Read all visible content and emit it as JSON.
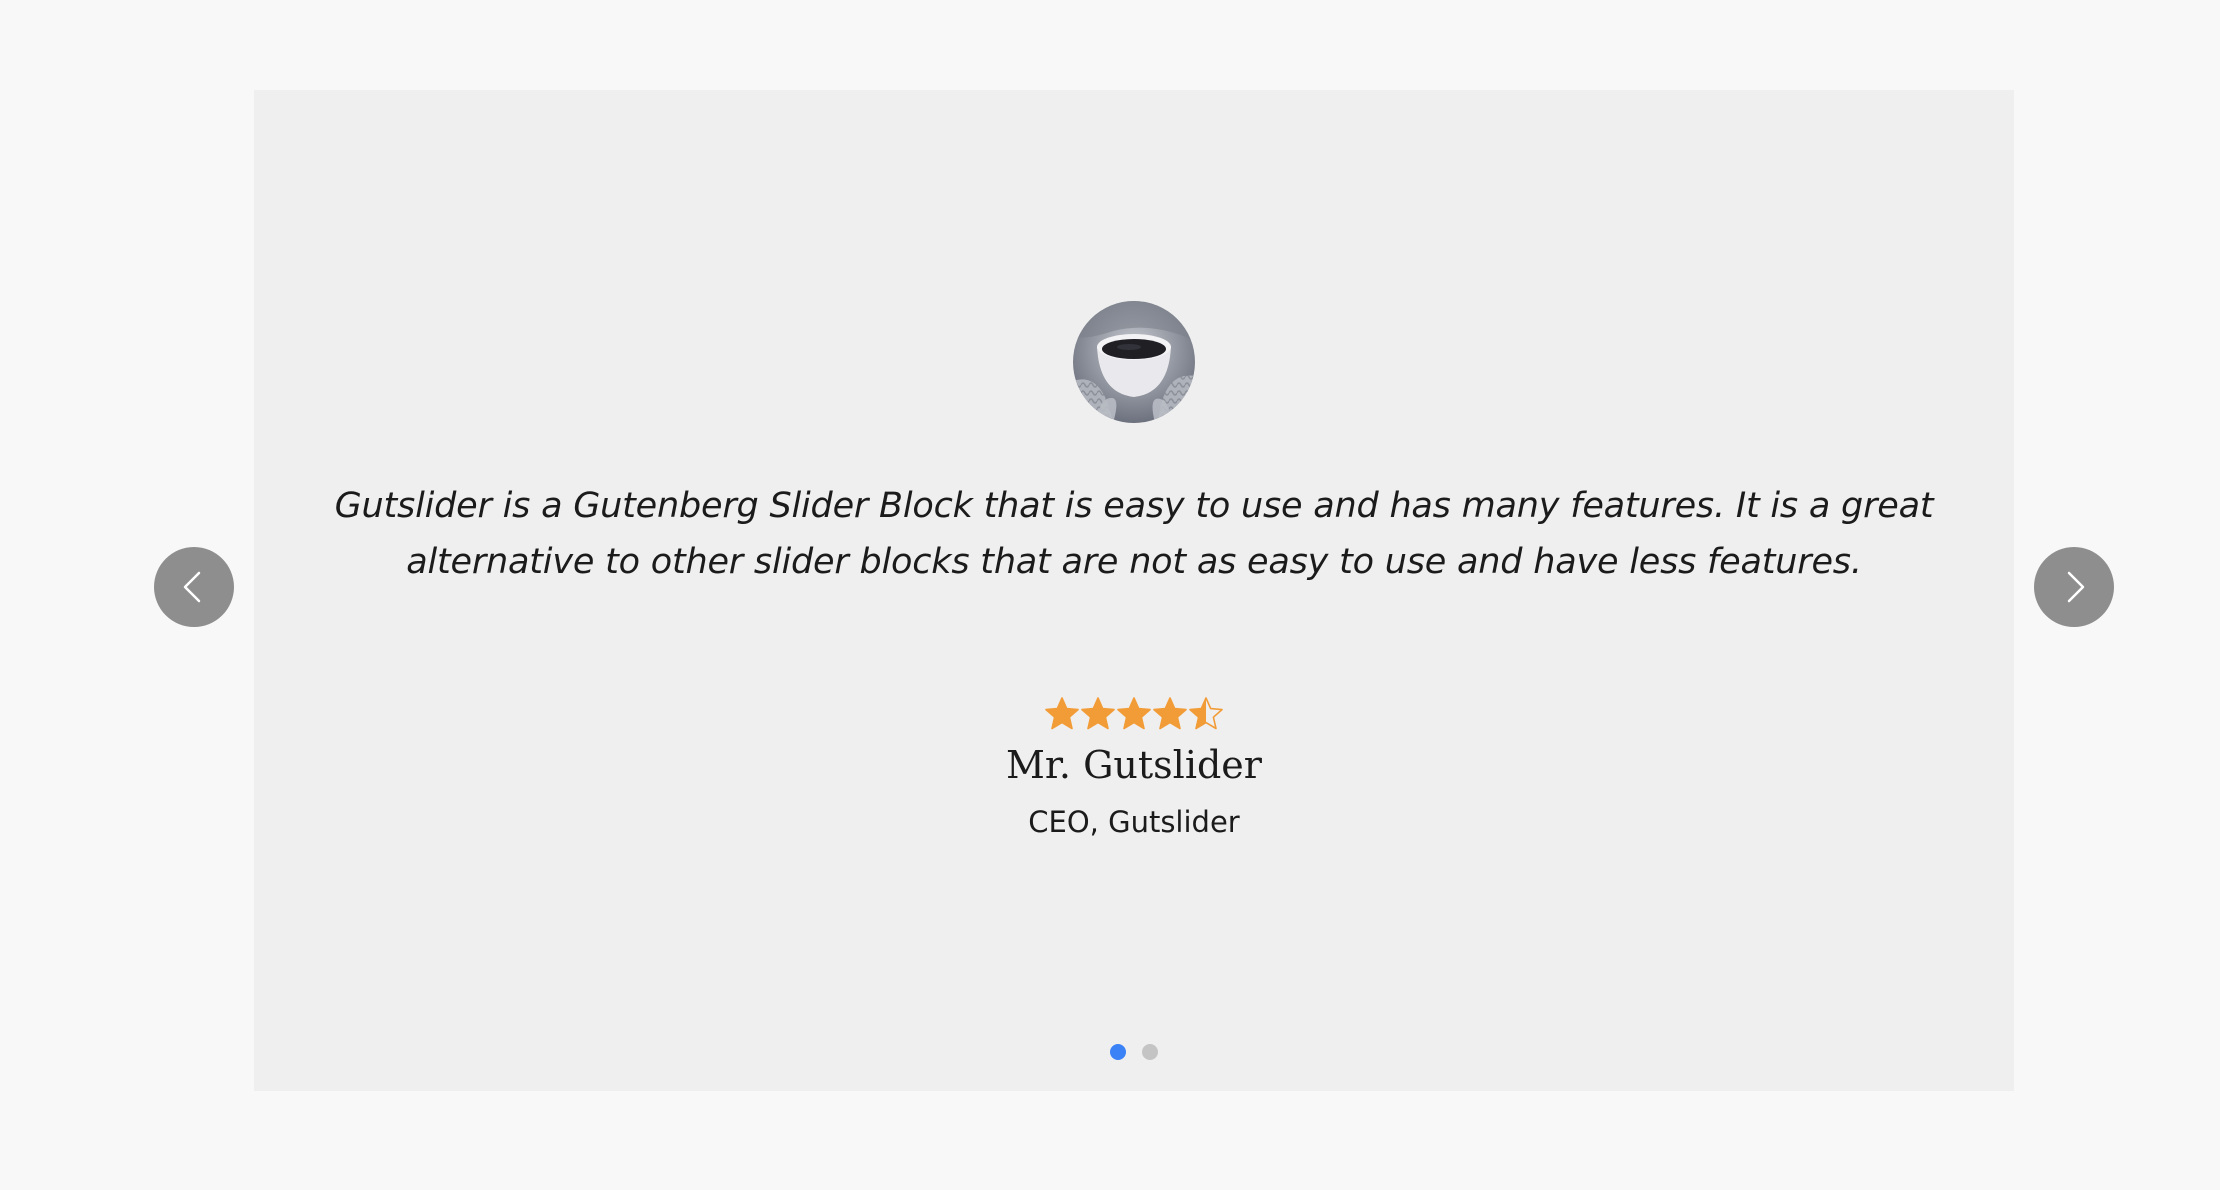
{
  "testimonial": {
    "quote": "Gutslider is a Gutenberg Slider Block that is easy to use and has many features. It is a great alternative to other slider blocks that are not as easy to use and have less features.",
    "name": "Mr. Gutslider",
    "role": "CEO, Gutslider",
    "rating": 4.5,
    "rating_max": 5,
    "avatar_icon": "coffee-cup-photo"
  },
  "navigation": {
    "prev_icon": "chevron-left-icon",
    "next_icon": "chevron-right-icon"
  },
  "pagination": {
    "slide_count": 2,
    "active_index": 0
  },
  "colors": {
    "star": "#f29c38",
    "active_dot": "#3b82f6",
    "inactive_dot": "#c4c4c4",
    "nav_button": "#8e8e8e",
    "slide_background": "#efefef",
    "page_background": "#f8f8f8"
  }
}
